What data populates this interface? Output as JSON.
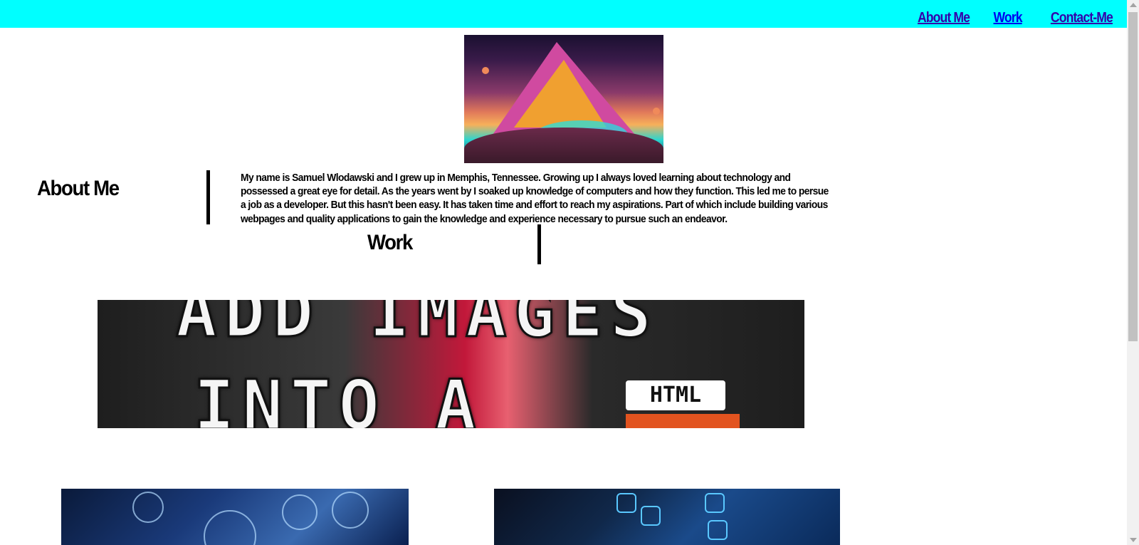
{
  "nav": {
    "items": [
      {
        "label": "About Me"
      },
      {
        "label": "Work"
      },
      {
        "label": "Contact-Me"
      }
    ]
  },
  "colors": {
    "header_bg": "#00ffff",
    "nav_link": "#3300aa",
    "nav_link_active": "#0000ee",
    "text": "#000000"
  },
  "hero": {
    "alt": "fantasy-mountain-image"
  },
  "about": {
    "title": "About Me",
    "body": "My name is Samuel Wlodawski and I grew up in Memphis, Tennessee. Growing up I always loved learning about technology and possessed a great eye for detail. As the years went by I soaked up knowledge of computers and how they function. This led me to persue a job as a developer. But this hasn't been easy. It has taken time and effort to reach my aspirations. Part of which include building various webpages and quality applications to gain the knowledge and experience necessary to pursue such an endeavor."
  },
  "work": {
    "title": "Work",
    "banner": {
      "line1": "ADD IMAGES",
      "line2": "INTO A",
      "tag": "HTML"
    }
  }
}
